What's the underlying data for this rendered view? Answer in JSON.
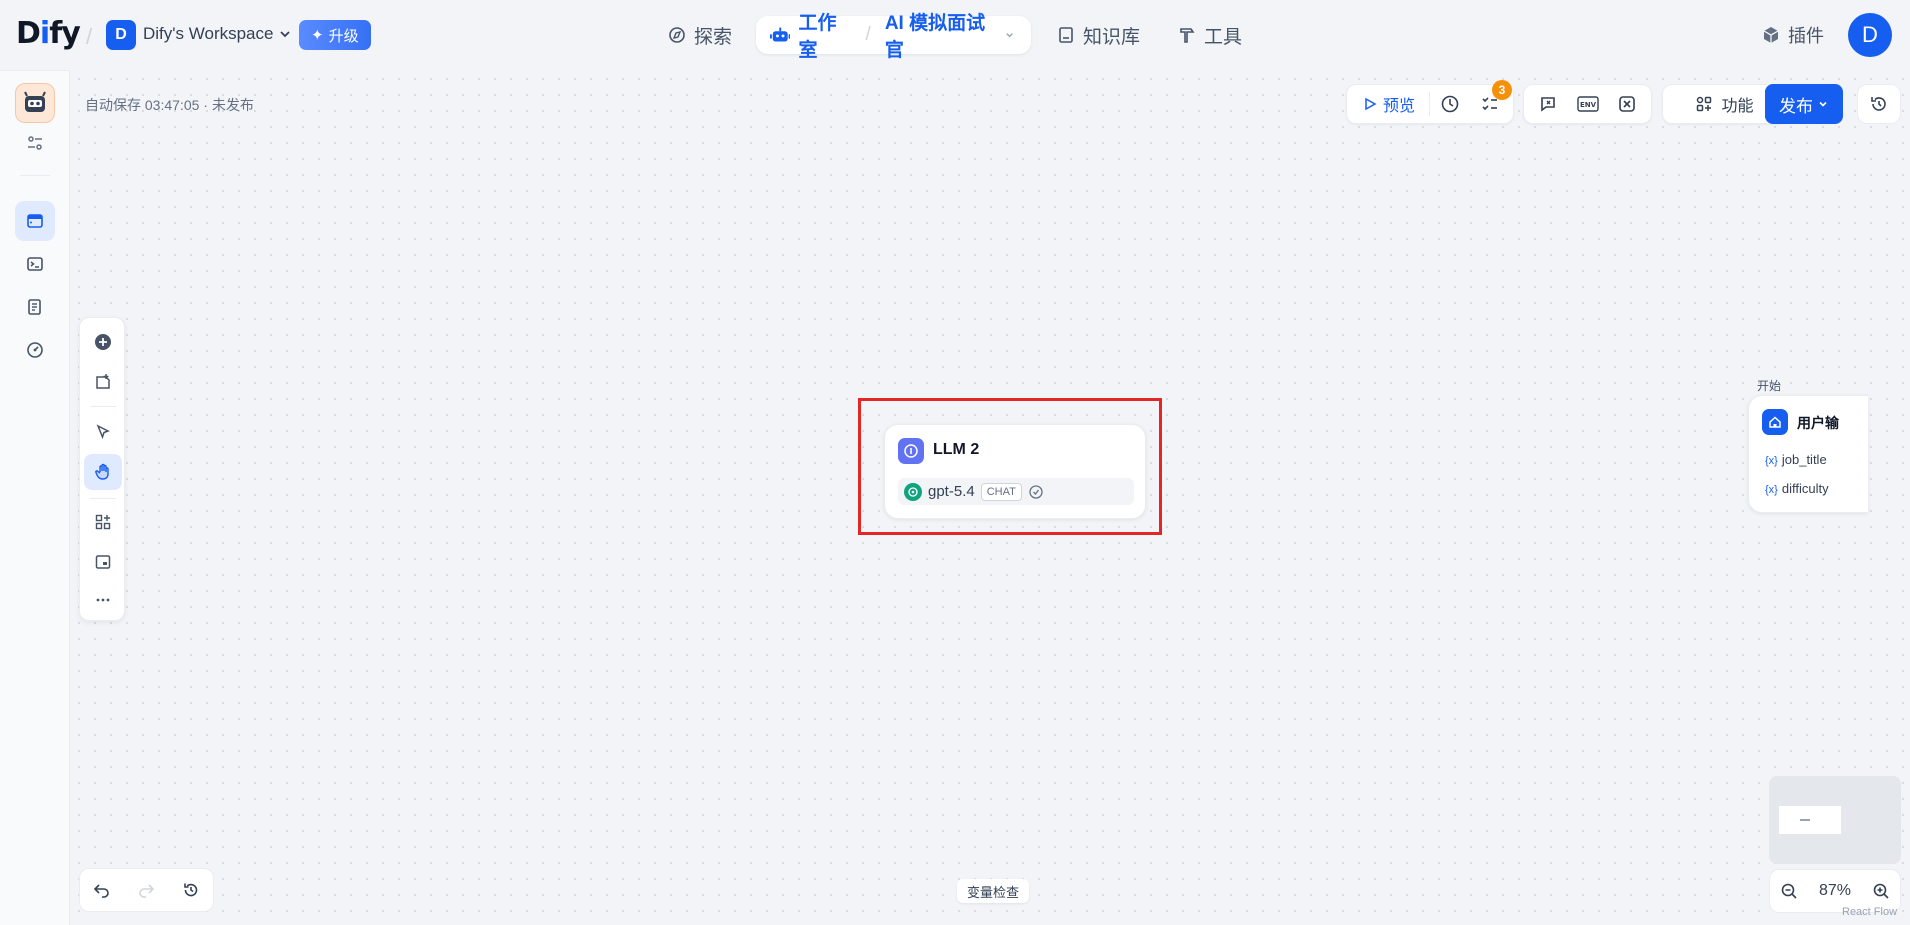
{
  "header": {
    "logo": "Dify",
    "workspace_initial": "D",
    "workspace_name": "Dify's Workspace",
    "upgrade_label": "升级",
    "nav": {
      "explore": "探索",
      "studio": "工作室",
      "app_name": "AI 模拟面试官",
      "knowledge": "知识库",
      "tools": "工具",
      "plugins": "插件"
    },
    "user_initial": "D"
  },
  "canvas": {
    "autosave": "自动保存 03:47:05 · 未发布",
    "toolbar": {
      "preview_label": "预览",
      "checklist_badge": "3",
      "env_label": "ENV",
      "feature_label": "功能",
      "publish_label": "发布"
    },
    "llm_node": {
      "title": "LLM 2",
      "model_name": "gpt-5.4",
      "model_mode": "CHAT"
    },
    "start_node": {
      "label": "开始",
      "title": "用户输",
      "variables": [
        "job_title",
        "difficulty"
      ]
    },
    "variable_inspect": "变量检查",
    "zoom": "87%",
    "attribution": "React Flow"
  },
  "colors": {
    "primary": "#155eef",
    "highlight": "#e32727",
    "badge": "#f79009",
    "llm_icon": "#6172f3"
  }
}
